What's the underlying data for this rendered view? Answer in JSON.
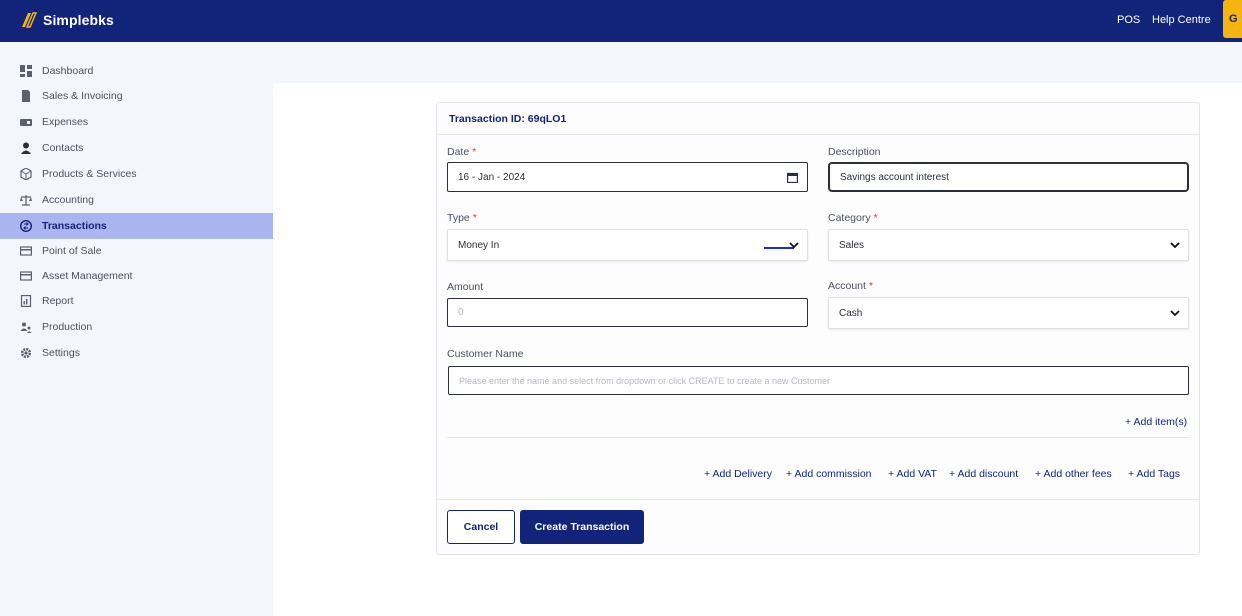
{
  "app": {
    "brand": "Simplebks",
    "brand_color": "#12237a",
    "accent_color": "#f6b40e"
  },
  "topnav": {
    "links": [
      "POS",
      "Help Centre"
    ],
    "cta_label": "G"
  },
  "sidebar": {
    "items": [
      {
        "label": "Dashboard",
        "icon": "dashboard-icon"
      },
      {
        "label": "Sales & Invoicing",
        "icon": "file-icon"
      },
      {
        "label": "Expenses",
        "icon": "wallet-icon"
      },
      {
        "label": "Contacts",
        "icon": "user-icon"
      },
      {
        "label": "Products & Services",
        "icon": "box-icon"
      },
      {
        "label": "Accounting",
        "icon": "scale-icon"
      },
      {
        "label": "Transactions",
        "icon": "transfer-icon",
        "active": true
      },
      {
        "label": "Point of Sale",
        "icon": "card-icon"
      },
      {
        "label": "Asset Management",
        "icon": "card-icon"
      },
      {
        "label": "Report",
        "icon": "report-icon"
      },
      {
        "label": "Production",
        "icon": "people-icon"
      },
      {
        "label": "Settings",
        "icon": "gear-icon"
      }
    ]
  },
  "form": {
    "transaction_id_label": "Transaction ID: 69qLO1",
    "date": {
      "label": "Date",
      "value": "16 - Jan - 2024"
    },
    "description": {
      "label": "Description",
      "value": "Savings account interest"
    },
    "type": {
      "label": "Type",
      "value": "Money In"
    },
    "category": {
      "label": "Category",
      "value": "Sales"
    },
    "amount": {
      "label": "Amount",
      "placeholder": "0"
    },
    "account": {
      "label": "Account",
      "value": "Cash"
    },
    "customer": {
      "label": "Customer Name",
      "placeholder": "Please enter the name and select from dropdown or click CREATE to create a new Customer"
    },
    "add_items": "+ Add item(s)",
    "extras": [
      "+ Add Delivery",
      "+ Add commission",
      "+ Add VAT",
      "+ Add discount",
      "+ Add other fees",
      "+ Add Tags"
    ],
    "cancel_label": "Cancel",
    "create_label": "Create Transaction"
  }
}
